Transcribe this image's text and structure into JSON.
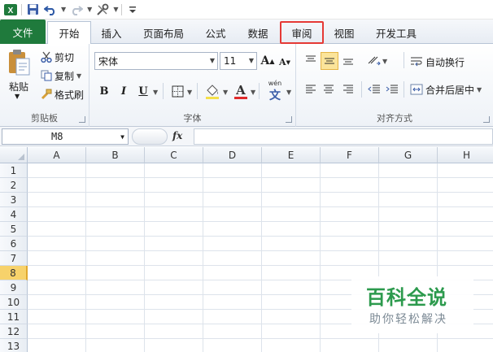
{
  "quick_access": {
    "app_icon": "excel-icon",
    "items": [
      "save-icon",
      "undo-icon",
      "redo-icon",
      "tools-icon",
      "customize-icon"
    ]
  },
  "tabs": [
    {
      "label": "文件"
    },
    {
      "label": "开始"
    },
    {
      "label": "插入"
    },
    {
      "label": "页面布局"
    },
    {
      "label": "公式"
    },
    {
      "label": "数据"
    },
    {
      "label": "审阅"
    },
    {
      "label": "视图"
    },
    {
      "label": "开发工具"
    }
  ],
  "ribbon": {
    "clipboard": {
      "paste_label": "粘贴",
      "cut_label": "剪切",
      "copy_label": "复制",
      "format_painter_label": "格式刷",
      "group_label": "剪贴板"
    },
    "font": {
      "font_name": "宋体",
      "font_size": "11",
      "bold": "B",
      "italic": "I",
      "underline": "U",
      "group_label": "字体",
      "phonetic": "wén"
    },
    "alignment": {
      "wrap_text_label": "自动换行",
      "merge_center_label": "合并后居中",
      "group_label": "对齐方式"
    }
  },
  "formula_bar": {
    "name_box": "M8",
    "fx_label": "fx",
    "value": ""
  },
  "sheet": {
    "columns": [
      "A",
      "B",
      "C",
      "D",
      "E",
      "F",
      "G",
      "H"
    ],
    "rows": [
      "1",
      "2",
      "3",
      "4",
      "5",
      "6",
      "7",
      "8",
      "9",
      "10",
      "11",
      "12",
      "13"
    ],
    "active_row": "8"
  },
  "watermark": {
    "title": "百科全说",
    "subtitle": "助你轻松解决"
  },
  "colors": {
    "file_tab": "#1f7a3c",
    "highlight_box": "#e53935",
    "active_row_header": "#f7d26b",
    "watermark_green": "#2c9a4d"
  }
}
